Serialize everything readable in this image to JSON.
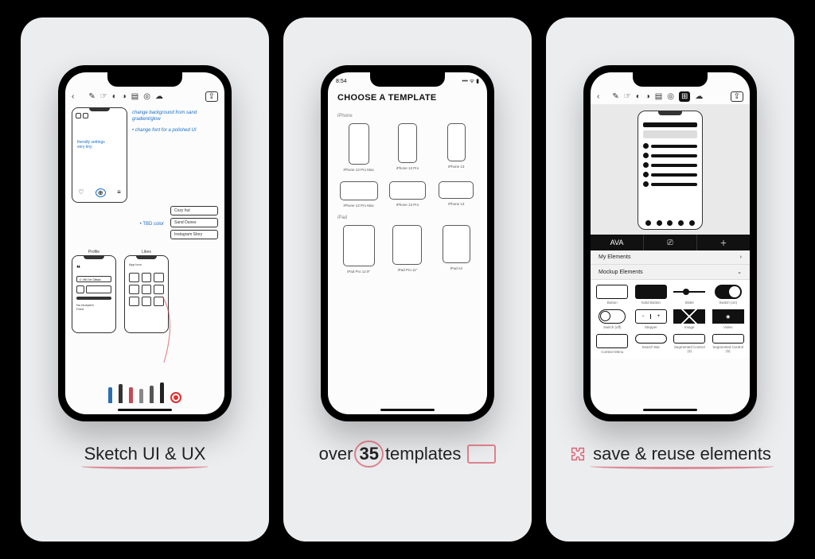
{
  "captions": {
    "c1": "Sketch UI & UX",
    "c2_pre": "over",
    "c2_num": "35",
    "c2_post": "templates",
    "c3": "save & reuse elements"
  },
  "screen1": {
    "note1": "change background from sand\ngradient/glow",
    "note2": "• change font for a polished UI",
    "note_color": "• TBD color",
    "list": [
      "Cozy hut",
      "Sand Dunes",
      "Instagram Story"
    ],
    "wf_label_1": "Profile",
    "wf_label_2": "Likes"
  },
  "screen2": {
    "status_time": "8:54",
    "title": "CHOOSE A TEMPLATE",
    "section_iphone": "iPhone",
    "section_ipad": "iPad",
    "iphone_portrait": [
      "iPhone 13 Pro Max",
      "iPhone 13 Pro",
      "iPhone 13"
    ],
    "iphone_landscape": [
      "iPhone 13 Pro Max",
      "iPhone 13 Pro",
      "iPhone 13"
    ],
    "ipad": [
      "iPad Pro 12.9\"",
      "iPad Pro 11\"",
      "iPad Air"
    ]
  },
  "screen3": {
    "seg_text": "AVA",
    "section_my": "My Elements",
    "section_mockup": "Mockup Elements",
    "elements_row1": [
      "Button",
      "Solid Button",
      "Slider",
      "Switch (on)"
    ],
    "elements_row2": [
      "Switch (off)",
      "Stepper",
      "Image",
      "Video"
    ],
    "elements_row3": [
      "Context Menu",
      "Search Bar",
      "Segmented Control (3)",
      "Segmented Control (5)"
    ]
  }
}
